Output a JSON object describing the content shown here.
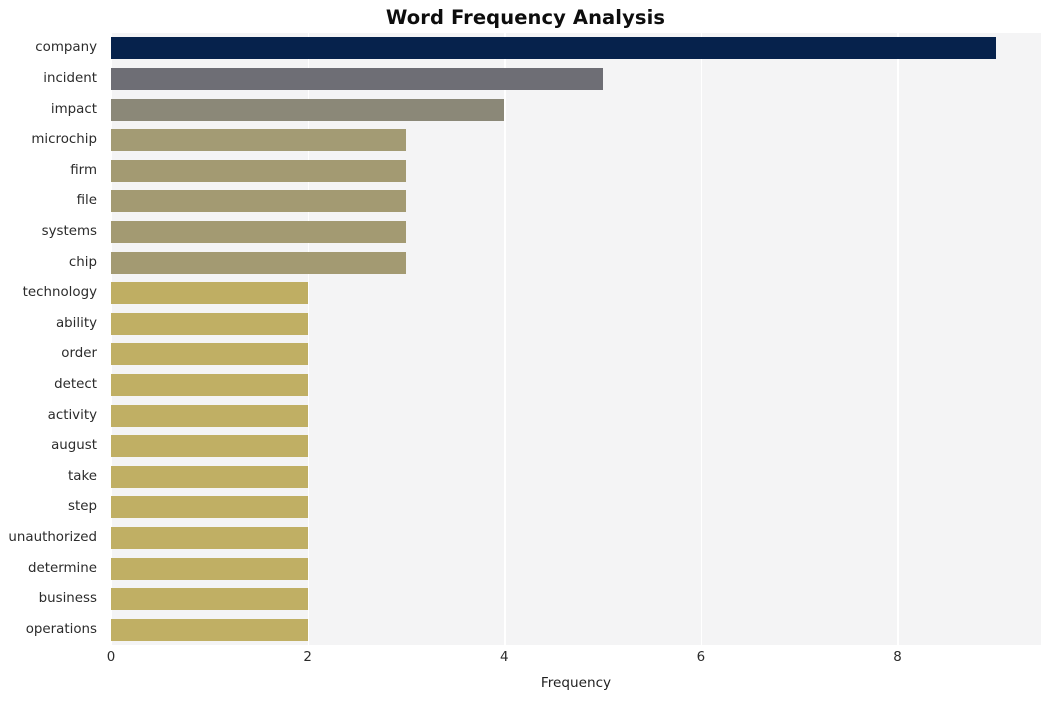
{
  "chart_data": {
    "type": "bar",
    "orientation": "horizontal",
    "title": "Word Frequency Analysis",
    "xlabel": "Frequency",
    "ylabel": "",
    "xlim": [
      0,
      9.46
    ],
    "xticks": [
      0,
      2,
      4,
      6,
      8
    ],
    "xtick_labels": [
      "0",
      "2",
      "4",
      "6",
      "8"
    ],
    "grid": "vertical-only",
    "legend": "none",
    "categories": [
      "company",
      "incident",
      "impact",
      "microchip",
      "firm",
      "file",
      "systems",
      "chip",
      "technology",
      "ability",
      "order",
      "detect",
      "activity",
      "august",
      "take",
      "step",
      "unauthorized",
      "determine",
      "business",
      "operations"
    ],
    "values": [
      9,
      5,
      4,
      3,
      3,
      3,
      3,
      3,
      2,
      2,
      2,
      2,
      2,
      2,
      2,
      2,
      2,
      2,
      2,
      2
    ],
    "bar_colors": [
      "#06224c",
      "#6e6e75",
      "#8b8878",
      "#a39b74",
      "#a39a72",
      "#a39a72",
      "#a39a72",
      "#a39a72",
      "#bfae63",
      "#c0af64",
      "#c0af64",
      "#c0af64",
      "#c0af64",
      "#c0af64",
      "#c0af64",
      "#c0af64",
      "#c0af64",
      "#c0af64",
      "#c0af64",
      "#c0af64"
    ],
    "plot_background": "#f4f4f5",
    "gridline_color": "#ffffff",
    "figure_background": "#ffffff"
  }
}
